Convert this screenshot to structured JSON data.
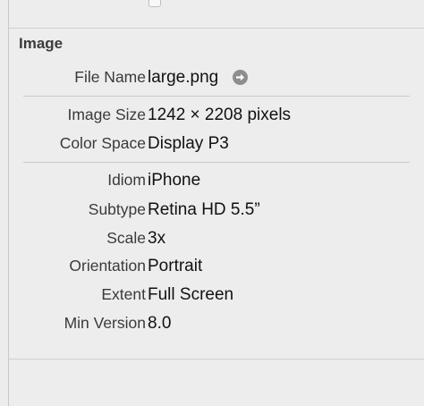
{
  "section": {
    "title": "Image"
  },
  "file": {
    "label": "File Name",
    "value": "large.png",
    "link_icon": "arrow-right-circle-icon"
  },
  "properties": [
    {
      "label": "Image Size",
      "value": "1242 × 2208 pixels"
    },
    {
      "label": "Color Space",
      "value": "Display P3"
    }
  ],
  "device": [
    {
      "label": "Idiom",
      "value": "iPhone"
    },
    {
      "label": "Subtype",
      "value": "Retina HD 5.5”"
    },
    {
      "label": "Scale",
      "value": "3x"
    },
    {
      "label": "Orientation",
      "value": "Portrait"
    },
    {
      "label": "Extent",
      "value": "Full Screen"
    },
    {
      "label": "Min Version",
      "value": "8.0"
    }
  ],
  "colors": {
    "background": "#ececec",
    "label": "#3a3a3a",
    "value": "#111111",
    "divider": "#c9c9c9"
  }
}
